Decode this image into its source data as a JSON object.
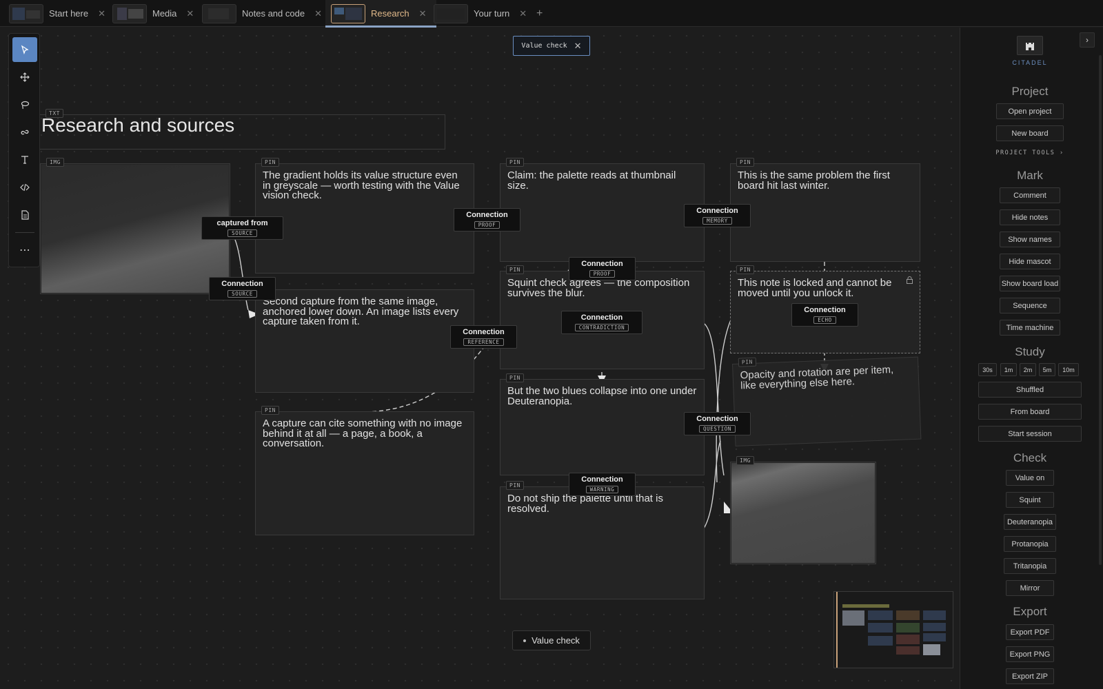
{
  "tabs": [
    {
      "label": "Start here",
      "active": false
    },
    {
      "label": "Media",
      "active": false
    },
    {
      "label": "Notes and code",
      "active": false
    },
    {
      "label": "Research",
      "active": true
    },
    {
      "label": "Your turn",
      "active": false
    }
  ],
  "tab_close_glyph": "✕",
  "tab_add_glyph": "+",
  "toolbar": {
    "tools": [
      "select-icon",
      "move-icon",
      "lasso-icon",
      "link-icon",
      "text-icon",
      "code-icon",
      "document-icon"
    ],
    "more_glyph": "⋯"
  },
  "value_chip": {
    "label": "Value check",
    "close": "✕"
  },
  "board": {
    "title": {
      "tag": "TXT",
      "text": "Research and sources"
    },
    "images": [
      {
        "tag": "IMG"
      },
      {
        "tag": "IMG"
      }
    ],
    "notes": [
      {
        "tag": "PIN",
        "text": "The gradient holds its value structure even in greyscale — worth testing with the Value vision check."
      },
      {
        "tag": "PIN",
        "text": "Second capture from the same image, anchored lower down. An image lists every capture taken from it."
      },
      {
        "tag": "PIN",
        "text": "A capture can cite something with no image behind it at all — a page, a book, a conversation."
      },
      {
        "tag": "PIN",
        "text": "Claim: the palette reads at thumbnail size."
      },
      {
        "tag": "PIN",
        "text": "Squint check agrees — the composition survives the blur."
      },
      {
        "tag": "PIN",
        "text": "But the two blues collapse into one under Deuteranopia."
      },
      {
        "tag": "PIN",
        "text": "Do not ship the palette until that is resolved."
      },
      {
        "tag": "PIN",
        "text": "This is the same problem the first board hit last winter."
      },
      {
        "tag": "PIN",
        "text": "This note is locked and cannot be moved until you unlock it."
      },
      {
        "tag": "PIN",
        "text": "Opacity and rotation are per item, like everything else here."
      }
    ],
    "connections": [
      {
        "label": "captured from",
        "kind": "SOURCE"
      },
      {
        "label": "Connection",
        "kind": "SOURCE"
      },
      {
        "label": "Connection",
        "kind": "PROOF"
      },
      {
        "label": "Connection",
        "kind": "MEMORY"
      },
      {
        "label": "Connection",
        "kind": "PROOF"
      },
      {
        "label": "Connection",
        "kind": "CONTRADICTION"
      },
      {
        "label": "Connection",
        "kind": "REFERENCE"
      },
      {
        "label": "Connection",
        "kind": "ECHO"
      },
      {
        "label": "Connection",
        "kind": "QUESTION"
      },
      {
        "label": "Connection",
        "kind": "WARNING"
      }
    ]
  },
  "status": {
    "label": "Value check"
  },
  "panel": {
    "brand": "CITADEL",
    "collapse_glyph": "›",
    "sections": {
      "project": "Project",
      "mark": "Mark",
      "study": "Study",
      "check": "Check",
      "export": "Export"
    },
    "project_buttons": [
      "Open project",
      "New board"
    ],
    "project_tools": "PROJECT TOOLS ›",
    "mark_buttons": [
      "Comment",
      "Hide notes",
      "Show names",
      "Hide mascot",
      "Show board load",
      "Sequence",
      "Time machine"
    ],
    "study_durations": [
      "30s",
      "1m",
      "2m",
      "5m",
      "10m"
    ],
    "study_buttons": [
      "Shuffled",
      "From board",
      "Start session"
    ],
    "check_buttons": [
      "Value on",
      "Squint",
      "Deuteranopia",
      "Protanopia",
      "Tritanopia",
      "Mirror"
    ],
    "export_buttons": [
      "Export PDF",
      "Export PNG",
      "Export ZIP"
    ]
  }
}
